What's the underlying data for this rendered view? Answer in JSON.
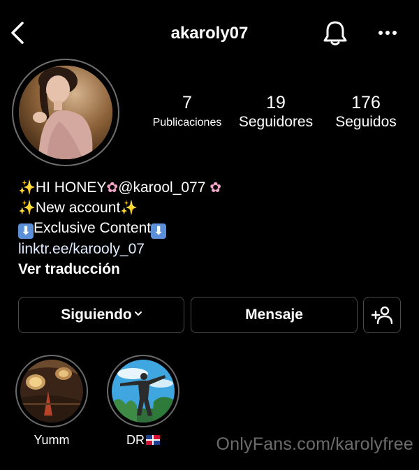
{
  "header": {
    "username": "akaroly07"
  },
  "stats": [
    {
      "value": "7",
      "label": "Publicaciones"
    },
    {
      "value": "19",
      "label": "Seguidores"
    },
    {
      "value": "176",
      "label": "Seguidos"
    }
  ],
  "bio": {
    "line1_text": "HI HONEY",
    "line1_handle": "@karool_077",
    "line2_text": "New account",
    "line3_text": "Exclusive Content",
    "link": "linktr.ee/karooly_07",
    "translate": "Ver traducción"
  },
  "emoji": {
    "sparkles": "✨",
    "flower": "✿",
    "down_arrow": "⬇"
  },
  "buttons": {
    "following": "Siguiendo",
    "message": "Mensaje"
  },
  "highlights": [
    {
      "label": "Yumm"
    },
    {
      "label": "DR"
    }
  ],
  "watermark": "OnlyFans.com/karolyfree",
  "colors": {
    "background": "#000000",
    "text": "#ffffff",
    "button_border": "#4a4a4a"
  },
  "icons": {
    "back": "chevron-left-icon",
    "notifications": "bell-icon",
    "menu": "more-icon",
    "add_user": "add-person-icon",
    "dropdown": "chevron-down-icon",
    "flag": "dominican-flag-icon"
  }
}
